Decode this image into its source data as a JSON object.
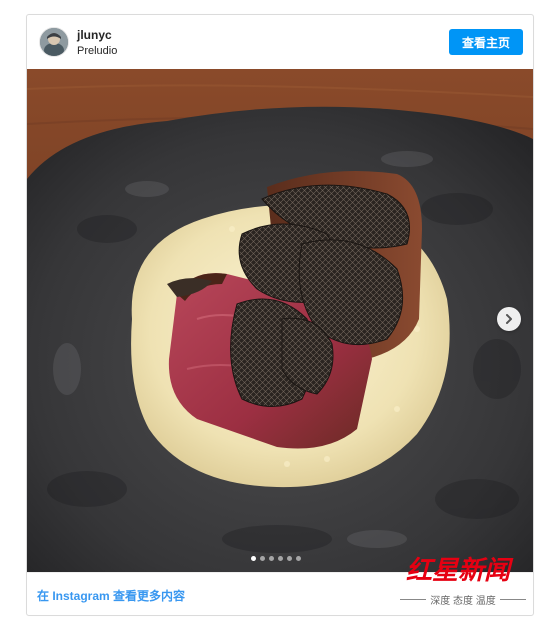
{
  "post": {
    "username": "jlunyc",
    "location": "Preludio",
    "view_profile_label": "查看主页",
    "carousel": {
      "total_slides": 6,
      "active_slide": 1
    },
    "footer_link": "在 Instagram 查看更多内容"
  },
  "watermark": {
    "logo_text": "红星新闻",
    "tagline": "深度 态度 温度"
  },
  "icons": {
    "next": "chevron-right-icon",
    "avatar": "avatar"
  },
  "colors": {
    "button_blue": "#0095f6",
    "link_blue": "#3897f0",
    "watermark_red": "#e60012"
  }
}
